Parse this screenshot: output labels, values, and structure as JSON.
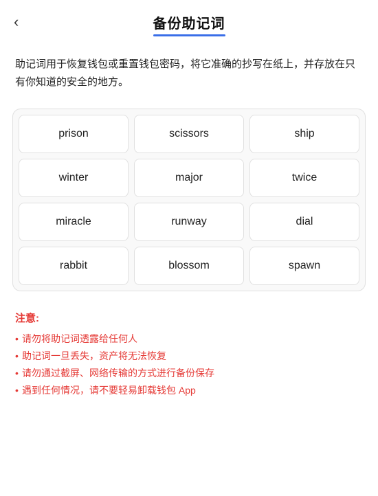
{
  "header": {
    "back_label": "‹",
    "title": "备份助记词",
    "underline_color": "#3a6ee8"
  },
  "description": "助记词用于恢复钱包或重置钱包密码，将它准确的抄写在纸上，并存放在只有你知道的安全的地方。",
  "mnemonic": {
    "words": [
      "prison",
      "scissors",
      "ship",
      "winter",
      "major",
      "twice",
      "miracle",
      "runway",
      "dial",
      "rabbit",
      "blossom",
      "spawn"
    ]
  },
  "notice": {
    "title": "注意:",
    "items": [
      "请勿将助记词透露给任何人",
      "助记词一旦丢失，资产将无法恢复",
      "请勿通过截屏、网络传输的方式进行备份保存",
      "遇到任何情况，请不要轻易卸载钱包 App"
    ]
  }
}
